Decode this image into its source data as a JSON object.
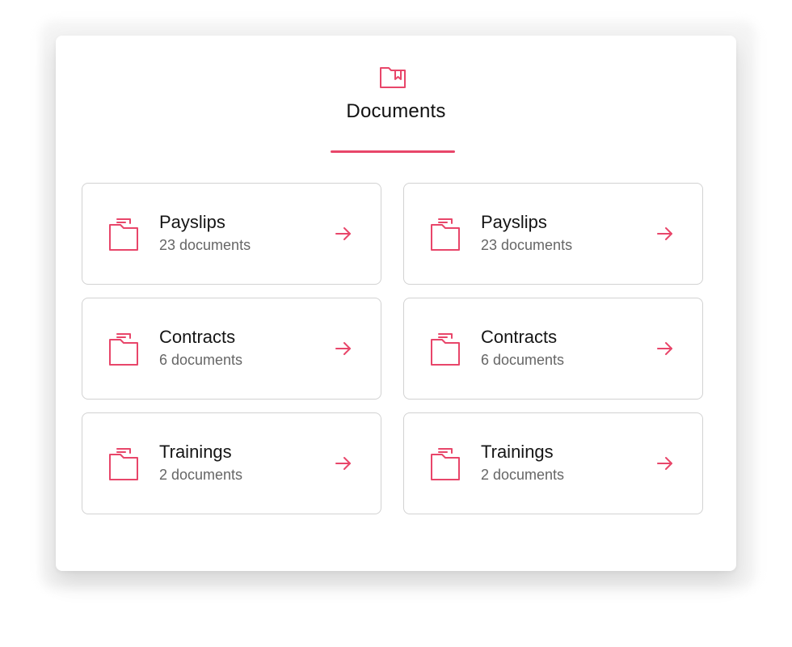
{
  "panel": {
    "title": "Documents",
    "header_icon": "folder-bookmark-icon",
    "accent_color": "#e8466a"
  },
  "categories": [
    {
      "name": "Payslips",
      "count": "23 documents",
      "icon": "folder-icon",
      "action_icon": "arrow-right-icon"
    },
    {
      "name": "Payslips",
      "count": "23 documents",
      "icon": "folder-icon",
      "action_icon": "arrow-right-icon"
    },
    {
      "name": "Contracts",
      "count": "6 documents",
      "icon": "folder-icon",
      "action_icon": "arrow-right-icon"
    },
    {
      "name": "Contracts",
      "count": "6 documents",
      "icon": "folder-icon",
      "action_icon": "arrow-right-icon"
    },
    {
      "name": "Trainings",
      "count": "2 documents",
      "icon": "folder-icon",
      "action_icon": "arrow-right-icon"
    },
    {
      "name": "Trainings",
      "count": "2 documents",
      "icon": "folder-icon",
      "action_icon": "arrow-right-icon"
    }
  ]
}
